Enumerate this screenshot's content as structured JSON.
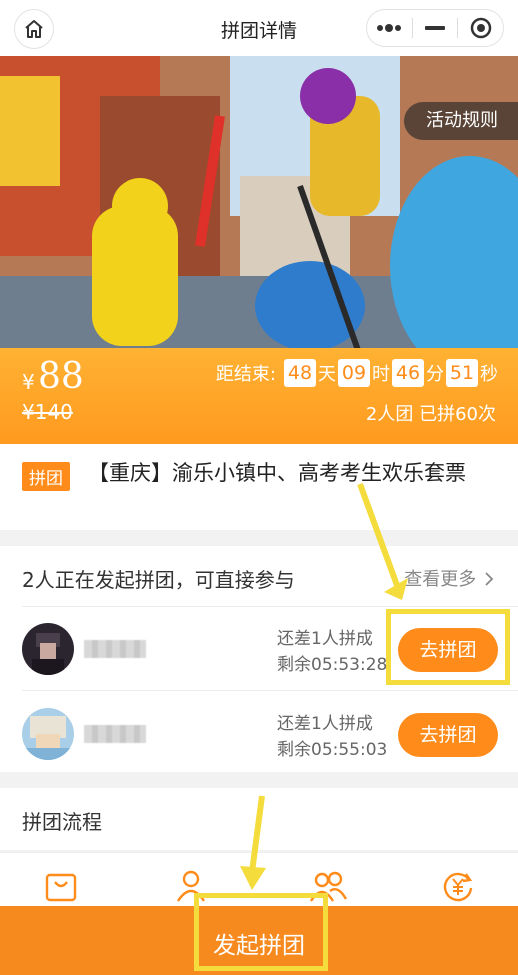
{
  "navbar": {
    "title": "拼团详情",
    "home_icon": "home-icon",
    "more_icon": "more-dots-icon",
    "minimize_icon": "minimize-icon",
    "close_icon": "target-close-icon"
  },
  "banner": {
    "rules_label": "活动规则"
  },
  "price": {
    "currency": "¥",
    "current": "88",
    "original": "¥140",
    "countdown_label": "距结束:",
    "days": "48",
    "days_unit": "天",
    "hours": "09",
    "hours_unit": "时",
    "minutes": "46",
    "minutes_unit": "分",
    "seconds": "51",
    "seconds_unit": "秒",
    "group_info": "2人团 已拼60次"
  },
  "product": {
    "tag": "拼团",
    "title": "【重庆】渝乐小镇中、高考考生欢乐套票"
  },
  "groups": {
    "heading": "2人正在发起拼团，可直接参与",
    "more_label": "查看更多",
    "items": [
      {
        "need": "还差1人拼成",
        "remain": "剩余05:53:28",
        "button": "去拼团"
      },
      {
        "need": "还差1人拼成",
        "remain": "剩余05:55:03",
        "button": "去拼团"
      }
    ]
  },
  "process": {
    "label": "拼团流程"
  },
  "tabbar": {
    "icons": [
      "shopping-bag-icon",
      "person-icon",
      "group-icon",
      "yen-refresh-icon"
    ]
  },
  "launch": {
    "label": "发起拼团"
  },
  "colors": {
    "accent": "#ff8c1a",
    "highlight": "#f4dc3c"
  }
}
